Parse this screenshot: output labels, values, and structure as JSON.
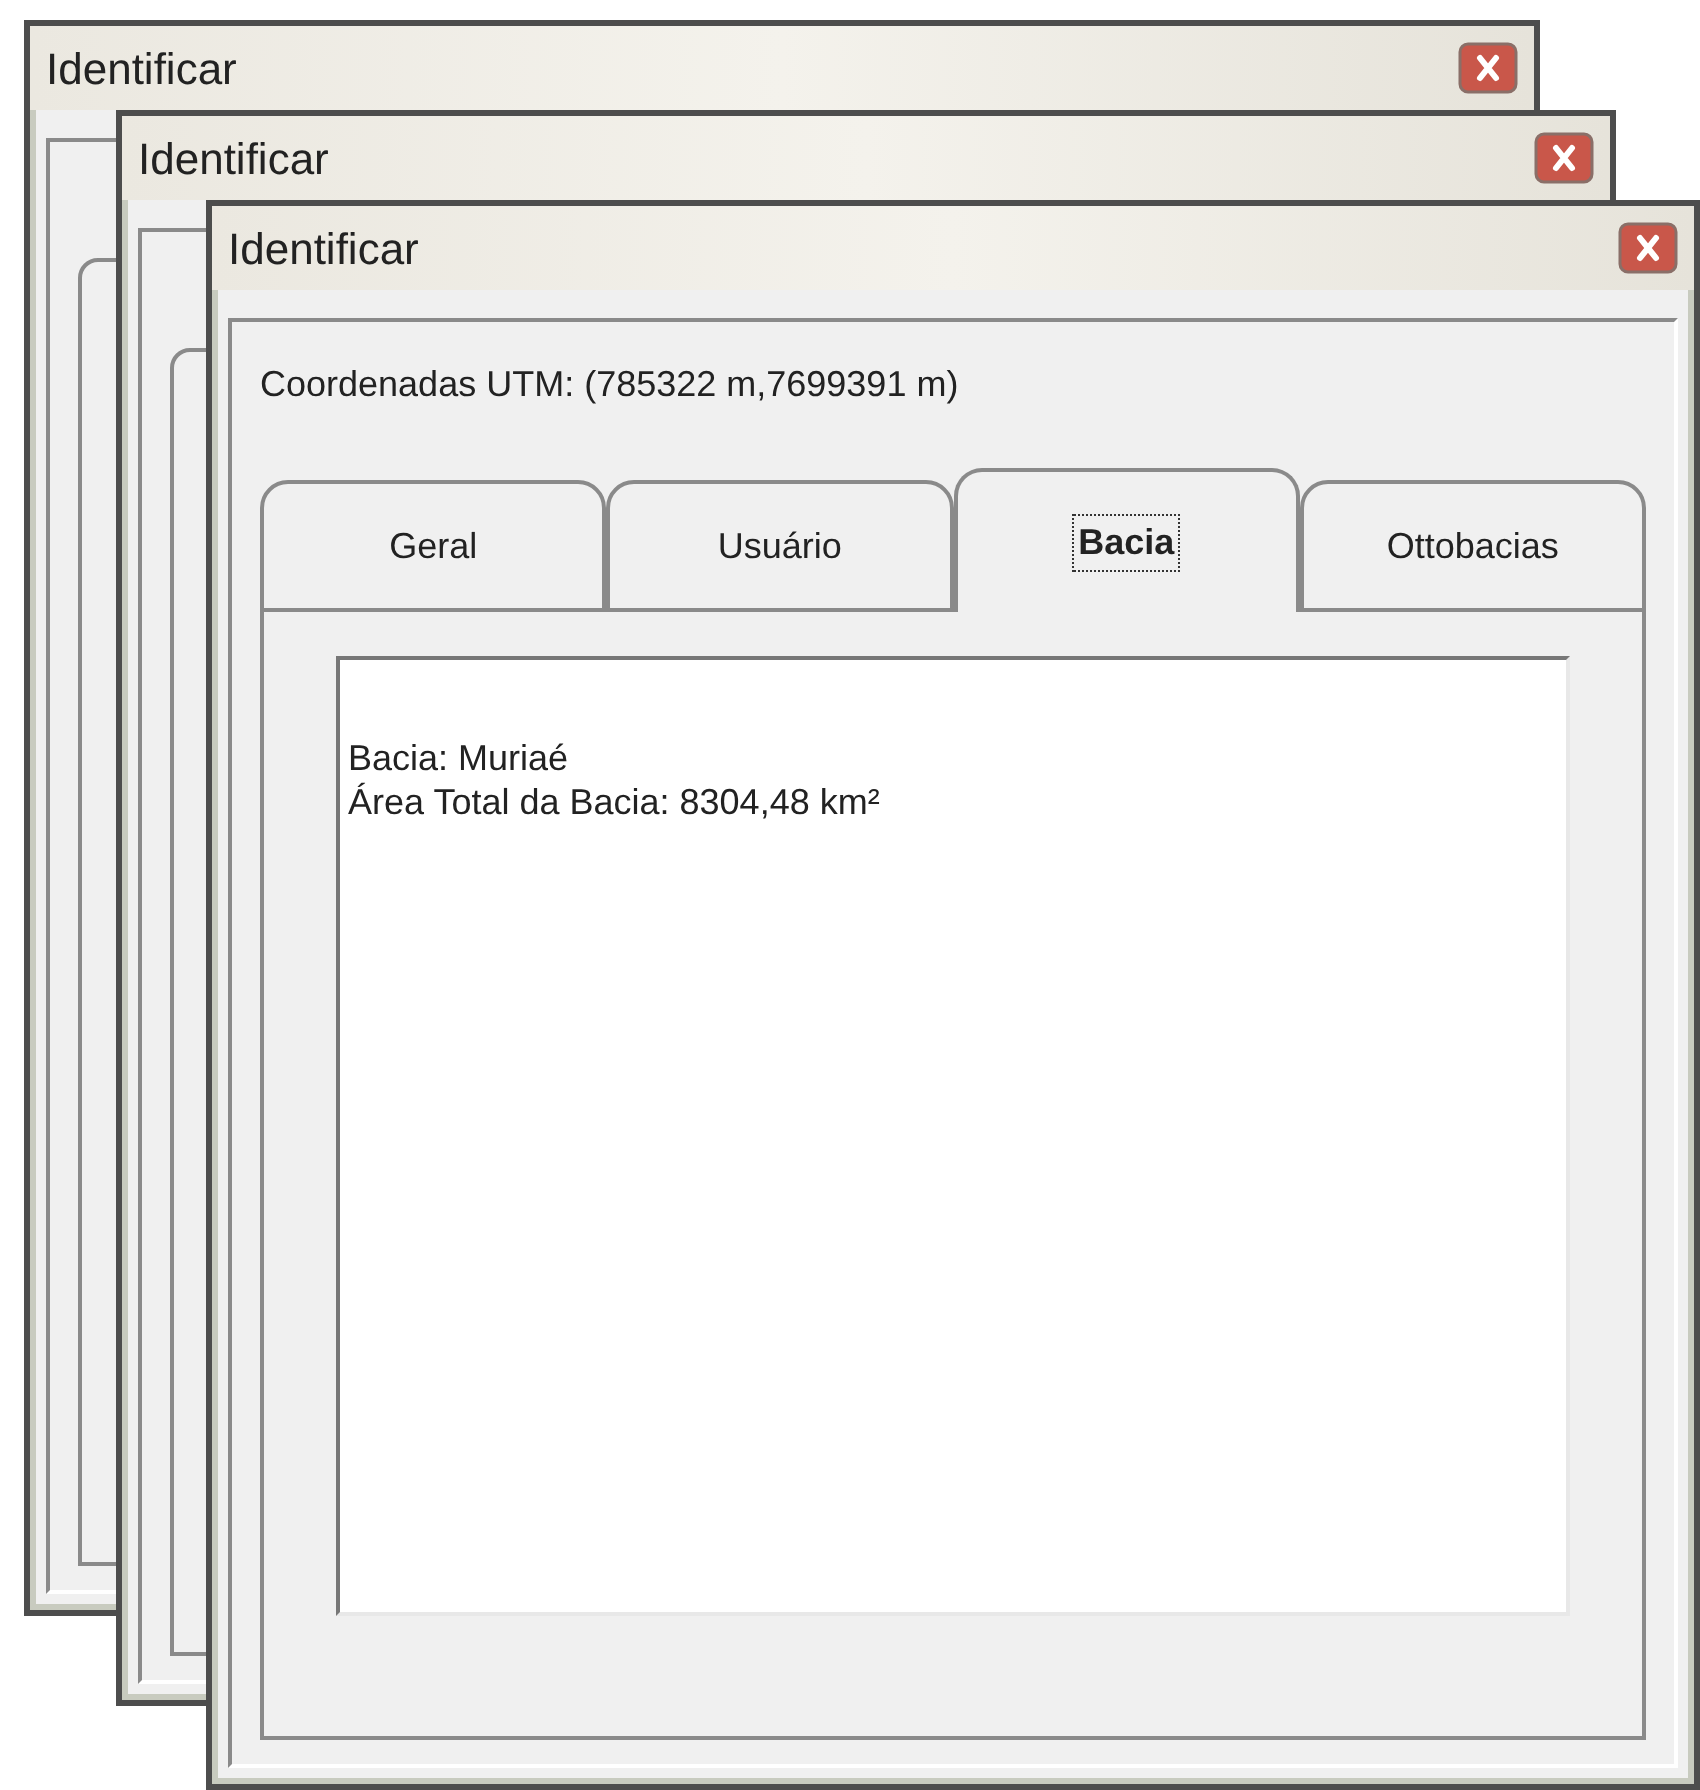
{
  "windows": [
    {
      "title": "Identificar"
    },
    {
      "title": "Identificar"
    },
    {
      "title": "Identificar",
      "coordinates": "Coordenadas UTM:  (785322 m,7699391 m)",
      "tabs": [
        {
          "label": "Geral",
          "selected": false
        },
        {
          "label": "Usuário",
          "selected": false
        },
        {
          "label": "Bacia",
          "selected": true
        },
        {
          "label": "Ottobacias",
          "selected": false
        }
      ],
      "content": [
        "Bacia: Muriaé",
        "Área Total da Bacia: 8304,48 km²"
      ]
    }
  ]
}
